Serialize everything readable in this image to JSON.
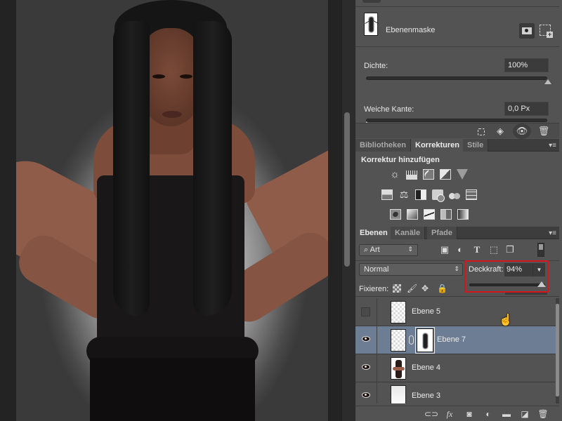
{
  "properties": {
    "mask_label": "Ebenenmaske",
    "density_label": "Dichte:",
    "density_value": "100%",
    "density_fraction": 1.0,
    "feather_label": "Weiche Kante:",
    "feather_value": "0,0 Px",
    "feather_fraction": 0.0,
    "icons": {
      "pixel_mask": "pixel-mask-icon",
      "vector_mask": "vector-mask-add-icon",
      "load_selection": "selection-from-mask-icon",
      "apply_mask": "apply-mask-icon",
      "toggle_mask": "eye-icon",
      "delete_mask": "trash-icon"
    }
  },
  "adjustments": {
    "tabs": [
      {
        "label": "Bibliotheken",
        "active": false
      },
      {
        "label": "Korrekturen",
        "active": true
      },
      {
        "label": "Stile",
        "active": false
      }
    ],
    "title": "Korrektur hinzufügen",
    "rows": [
      [
        "brightness-contrast",
        "levels",
        "curves",
        "exposure",
        "vibrance"
      ],
      [
        "hue-saturation",
        "color-balance",
        "black-white",
        "photo-filter",
        "channel-mixer",
        "color-lookup"
      ],
      [
        "invert",
        "posterize",
        "threshold",
        "selective-color",
        "gradient-map"
      ]
    ]
  },
  "layers": {
    "tabs": [
      {
        "label": "Ebenen",
        "active": true
      },
      {
        "label": "Kanäle",
        "active": false
      },
      {
        "label": "Pfade",
        "active": false
      }
    ],
    "filter_type": "Art",
    "blend_mode": "Normal",
    "opacity_label": "Deckkraft:",
    "opacity_value": "94%",
    "opacity_fraction": 0.94,
    "lock_label": "Fixieren:",
    "items": [
      {
        "name": "Ebene 5",
        "visible": false,
        "selected": false,
        "thumb": "transparent",
        "mask": false
      },
      {
        "name": "Ebene 7",
        "visible": true,
        "selected": true,
        "thumb": "transparent",
        "mask": true
      },
      {
        "name": "Ebene 4",
        "visible": true,
        "selected": false,
        "thumb": "photo",
        "mask": false
      },
      {
        "name": "Ebene 3",
        "visible": true,
        "selected": false,
        "thumb": "soft",
        "mask": false
      }
    ],
    "bottom_icons": [
      "link-layers-icon",
      "fx-icon",
      "add-mask-icon",
      "adjustment-layer-icon",
      "group-folder-icon",
      "new-layer-icon",
      "trash-icon"
    ],
    "fx_label": "fx"
  },
  "highlight_color": "#d8141c",
  "selection_color": "#6d7d94"
}
